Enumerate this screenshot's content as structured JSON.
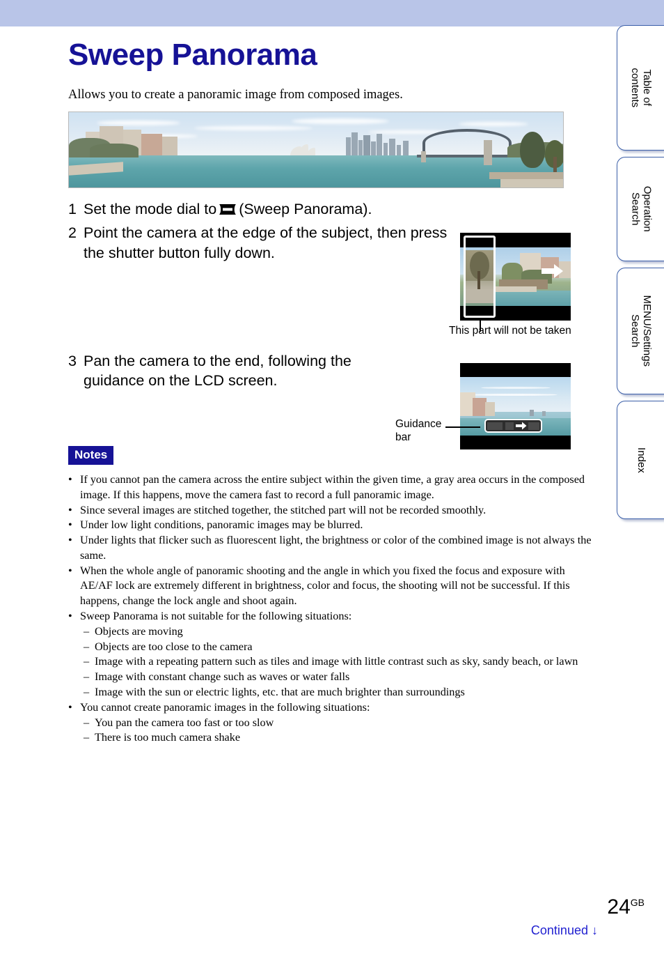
{
  "header": {
    "band_color": "#b9c5e8"
  },
  "page_title": "Sweep Panorama",
  "intro": "Allows you to create a panoramic image from composed images.",
  "title_color": "#161296",
  "side_tabs": [
    {
      "label": "Table of\ncontents",
      "name": "table-of-contents"
    },
    {
      "label": "Operation\nSearch",
      "name": "operation-search"
    },
    {
      "label": "MENU/Settings\nSearch",
      "name": "menu-settings-search"
    },
    {
      "label": "Index",
      "name": "index"
    }
  ],
  "steps": [
    {
      "number": "1",
      "text_before": "Set the mode dial to",
      "icon": "sweep-panorama-mode-icon",
      "text_after": "(Sweep Panorama)."
    },
    {
      "number": "2",
      "text": "Point the camera at the edge of the subject, then press the shutter button fully down."
    },
    {
      "number": "3",
      "text": "Pan the camera to the end, following the guidance on the LCD screen."
    }
  ],
  "figures": {
    "step2_caption": "This part will not be taken",
    "step3_caption": "Guidance\nbar"
  },
  "notes": {
    "badge": "Notes",
    "items": [
      {
        "level": 1,
        "text": "If you cannot pan the camera across the entire subject within the given time, a gray area occurs in the composed image. If this happens, move the camera fast to record a full panoramic image."
      },
      {
        "level": 1,
        "text": "Since several images are stitched together, the stitched part will not be recorded smoothly."
      },
      {
        "level": 1,
        "text": "Under low light conditions, panoramic images may be blurred."
      },
      {
        "level": 1,
        "text": "Under lights that flicker such as fluorescent light, the brightness or color of the combined image is not always the same."
      },
      {
        "level": 1,
        "text": "When the whole angle of panoramic shooting and the angle in which you fixed the focus and exposure with AE/AF lock are extremely different in brightness, color and focus, the shooting will not be successful. If this happens, change the lock angle and shoot again."
      },
      {
        "level": 1,
        "text": "Sweep Panorama is not suitable for the following situations:"
      },
      {
        "level": 2,
        "text": "Objects are moving"
      },
      {
        "level": 2,
        "text": "Objects are too close to the camera"
      },
      {
        "level": 2,
        "text": "Image with a repeating pattern such as tiles and image with little contrast such as sky, sandy beach, or lawn"
      },
      {
        "level": 2,
        "text": "Image with constant change such as waves or water falls"
      },
      {
        "level": 2,
        "text": "Image with the sun or electric lights, etc. that are much brighter than surroundings"
      },
      {
        "level": 1,
        "text": "You cannot create panoramic images in the following situations:"
      },
      {
        "level": 2,
        "text": "You pan the camera too fast or too slow"
      },
      {
        "level": 2,
        "text": "There is too much camera shake"
      }
    ]
  },
  "footer": {
    "page_number": "24",
    "page_suffix": "GB",
    "continued": "Continued",
    "continued_arrow": "↓",
    "continued_color": "#1f1fd0"
  },
  "bullets": {
    "level1": "•",
    "level2": "–"
  }
}
